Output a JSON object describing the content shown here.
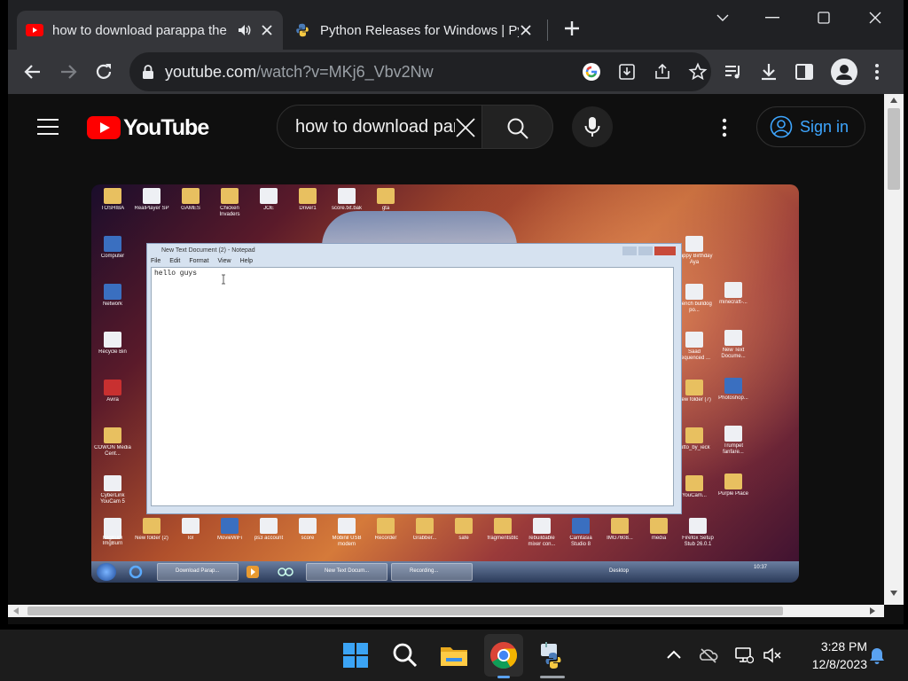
{
  "browser": {
    "tabs": [
      {
        "title": "how to download parappa the rapper on pc",
        "active": true,
        "audio": true
      },
      {
        "title": "Python Releases for Windows | Python.org",
        "active": false
      }
    ],
    "url_host": "youtube.com",
    "url_path": "/watch?v=MKj6_Vbv2Nw"
  },
  "youtube": {
    "logo_text": "YouTube",
    "search_query": "how to download parappa the rapper on pc",
    "sign_in_label": "Sign in"
  },
  "video": {
    "notepad_title": "New Text Document (2) - Notepad",
    "notepad_menu": [
      "File",
      "Edit",
      "Format",
      "View",
      "Help"
    ],
    "notepad_text": "hello guys",
    "taskbar_items": [
      "Download Parap...",
      "New Text Docum...",
      "Recording..."
    ],
    "clock": "10:37",
    "desktop_label": "Desktop",
    "desktop_icons_left": [
      {
        "label": "TOSHIBA",
        "kind": "f"
      },
      {
        "label": "RealPlayer SP",
        "kind": "d"
      },
      {
        "label": "GAMES",
        "kind": "f"
      },
      {
        "label": "Chicken Invaders",
        "kind": "f"
      },
      {
        "label": "JOE",
        "kind": "d"
      },
      {
        "label": "Driver1",
        "kind": "f"
      },
      {
        "label": "score.txt.bak",
        "kind": "d"
      },
      {
        "label": "gta",
        "kind": "f"
      }
    ],
    "desktop_icons_col": [
      {
        "label": "Computer",
        "kind": "b"
      },
      {
        "label": "Network",
        "kind": "b"
      },
      {
        "label": "Recycle Bin",
        "kind": "d"
      },
      {
        "label": "Avira",
        "kind": "r"
      },
      {
        "label": "COWON Media Cent...",
        "kind": "f"
      },
      {
        "label": "CyberLink YouCam 5",
        "kind": "d"
      },
      {
        "label": "ImgBurn",
        "kind": "d"
      }
    ],
    "desktop_icons_right": [
      {
        "label": "Happy Birthday Aya",
        "kind": "d"
      },
      {
        "label": "French bulldog po...",
        "kind": "d"
      },
      {
        "label": "Saad sequenced ...",
        "kind": "d"
      },
      {
        "label": "New folder (7)",
        "kind": "f"
      },
      {
        "label": "tutto_by_ieck",
        "kind": "f"
      },
      {
        "label": "YouCam...",
        "kind": "f"
      }
    ],
    "desktop_icons_right2": [
      {
        "label": "minecraft-...",
        "kind": "d"
      },
      {
        "label": "New Text Docume...",
        "kind": "d"
      },
      {
        "label": "Photoshop...",
        "kind": "b"
      },
      {
        "label": "Trumpet fanfare...",
        "kind": "d"
      },
      {
        "label": "Purple Place",
        "kind": "f"
      }
    ],
    "desktop_icons_bottom": [
      {
        "label": "ImgBurn",
        "kind": "d"
      },
      {
        "label": "New folder (2)",
        "kind": "f"
      },
      {
        "label": "lol",
        "kind": "d"
      },
      {
        "label": "MovieWiFi",
        "kind": "b"
      },
      {
        "label": "ps3 account",
        "kind": "d"
      },
      {
        "label": "score",
        "kind": "d"
      },
      {
        "label": "Mobinil USB modem",
        "kind": "d"
      },
      {
        "label": "Recorder",
        "kind": "f"
      },
      {
        "label": "Grabber...",
        "kind": "f"
      },
      {
        "label": "safe",
        "kind": "f"
      },
      {
        "label": "fragmentsbtc",
        "kind": "f"
      },
      {
        "label": "rebuildable mixer con...",
        "kind": "d"
      },
      {
        "label": "Camtasia Studio 8",
        "kind": "b"
      },
      {
        "label": "IMG7608...",
        "kind": "f"
      },
      {
        "label": "media",
        "kind": "f"
      },
      {
        "label": "Firefox Setup Stub 26.0.1",
        "kind": "d"
      }
    ]
  },
  "taskbar": {
    "time": "3:28 PM",
    "date": "12/8/2023"
  },
  "colors": {
    "tabstrip": "#202124",
    "toolbar": "#35363a",
    "youtube_bg": "#0f0f0f",
    "youtube_red": "#ff0000",
    "signin_blue": "#3ea6ff"
  }
}
